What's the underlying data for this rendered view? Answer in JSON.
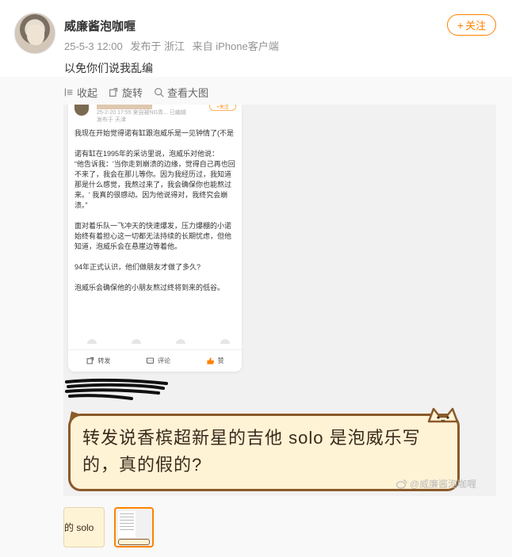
{
  "post": {
    "username": "威廉酱泡咖喱",
    "date": "25-5-3 12:00",
    "posted_from": "发布于 浙江",
    "device": "来自 iPhone客户端",
    "follow_label": "关注",
    "text": "以免你们说我乱编"
  },
  "toolbar": {
    "collapse": "收起",
    "rotate": "旋转",
    "view_large": "查看大图"
  },
  "embedded_card": {
    "meta_line1": "25-2-20 17:55  来自被NG青... 已编辑",
    "meta_line2": "发布于 天津",
    "follow_label": "+关注",
    "paragraphs": [
      "我现在开始觉得诺有缸跟泡威乐是一见钟情了(不是",
      "诺有缸在1995年的采访里说，泡威乐对他说：\n“他告诉我：'当你走到崩溃的边缘，觉得自己再也回不来了，我会在那儿等你。因为我经历过，我知道那是什么感觉，我熬过来了，我会确保你也能熬过来。' 我真的很感动。因为他说得对，我终究会崩溃。”",
      "面对着乐队一飞冲天的快速爆发，压力爆棚的小诺始终有着担心这一切都无法持续的长期忧虑，但他知道，泡威乐会在悬崖边等着他。",
      "94年正式认识，他们做朋友才做了多久?",
      "泡威乐会确保他的小朋友熬过终将到来的低谷。"
    ],
    "actions": {
      "repost": "转发",
      "comment": "评论",
      "like": "赞"
    }
  },
  "bubble_text": "转发说香槟超新星的吉他 solo 是泡威乐写的，真的假的?",
  "watermark": "@威廉酱泡咖喱",
  "thumbnail_text": "的 solo",
  "colors": {
    "accent": "#ff8200",
    "bubble_bg": "#fff3d6",
    "bubble_border": "#8a5a2b"
  }
}
